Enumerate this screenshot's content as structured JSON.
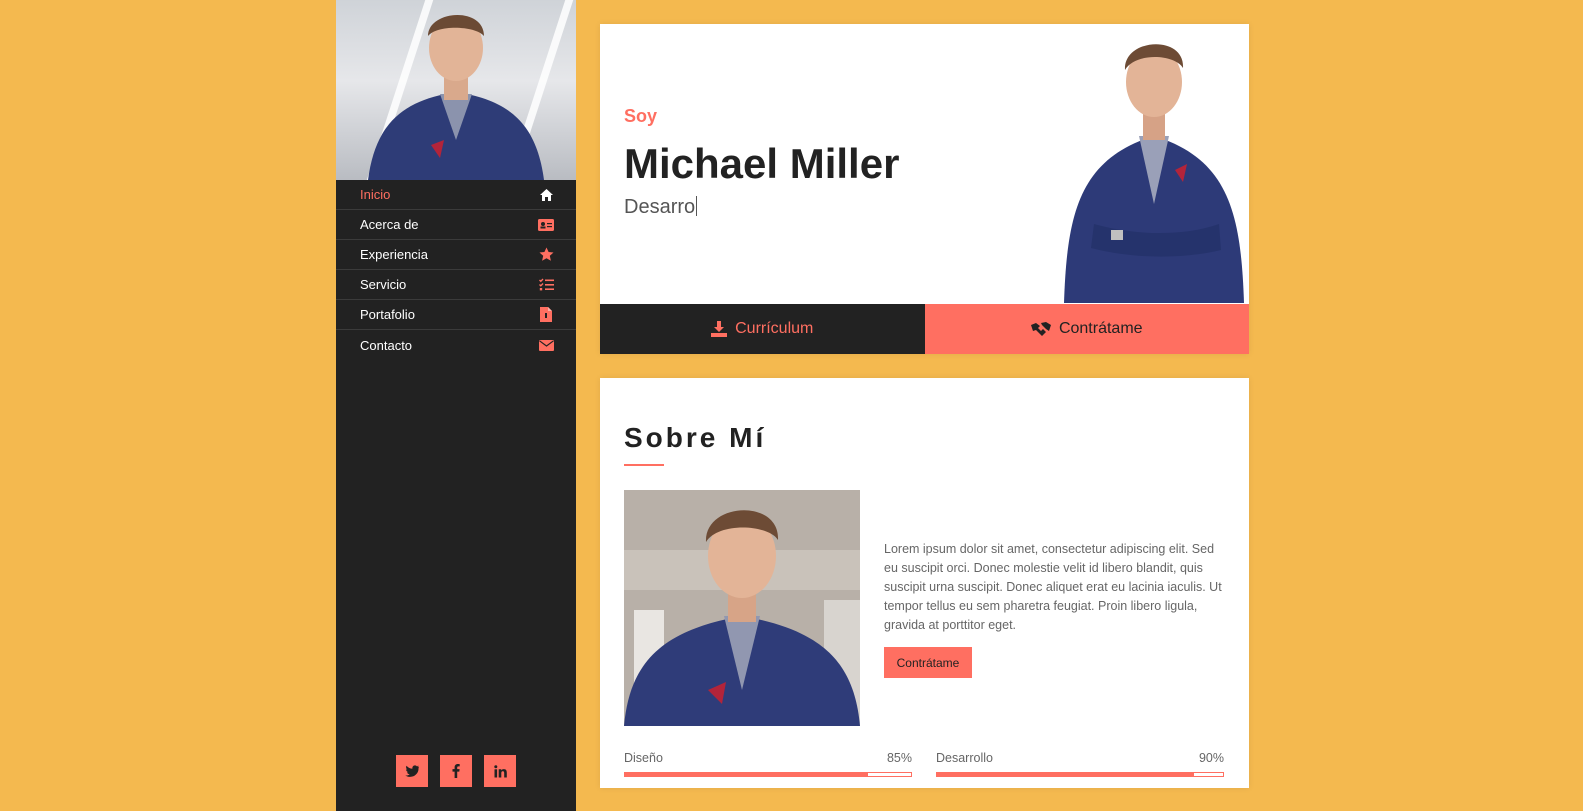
{
  "sidebar": {
    "items": [
      {
        "label": "Inicio",
        "icon": "home-icon",
        "active": true
      },
      {
        "label": "Acerca de",
        "icon": "id-card-icon",
        "active": false
      },
      {
        "label": "Experiencia",
        "icon": "star-icon",
        "active": false
      },
      {
        "label": "Servicio",
        "icon": "task-list-icon",
        "active": false
      },
      {
        "label": "Portafolio",
        "icon": "file-icon",
        "active": false
      },
      {
        "label": "Contacto",
        "icon": "envelope-icon",
        "active": false
      }
    ],
    "social": [
      "twitter-icon",
      "facebook-icon",
      "linkedin-icon"
    ]
  },
  "hero": {
    "intro": "Soy",
    "name": "Michael Miller",
    "role_typing": "Desarro",
    "cv_label": "Currículum",
    "hire_label": "Contrátame"
  },
  "about": {
    "title": "Sobre Mí",
    "text": "Lorem ipsum dolor sit amet, consectetur adipiscing elit. Sed eu suscipit orci. Donec molestie velit id libero blandit, quis suscipit urna suscipit. Donec aliquet erat eu lacinia iaculis. Ut tempor tellus eu sem pharetra feugiat. Proin libero ligula, gravida at porttitor eget.",
    "button": "Contrátame",
    "skills": [
      {
        "name": "Diseño",
        "percent": "85%",
        "value": 85
      },
      {
        "name": "Desarrollo",
        "percent": "90%",
        "value": 90
      }
    ]
  },
  "colors": {
    "background": "#f4b94f",
    "accent": "#ff6f61",
    "dark": "#222222"
  }
}
